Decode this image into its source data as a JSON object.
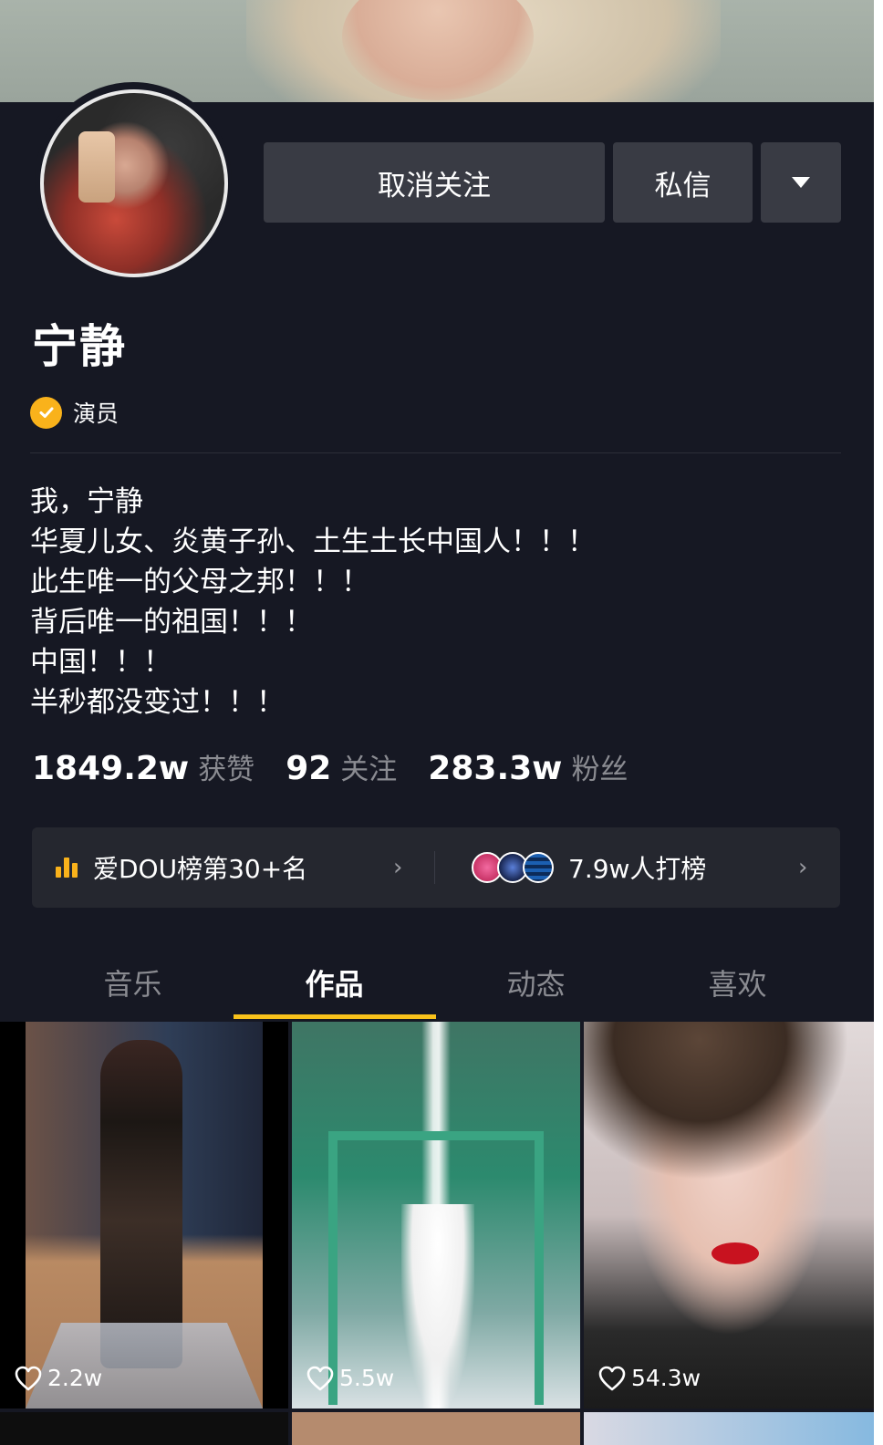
{
  "profile": {
    "name": "宁静",
    "verification": "演员",
    "bio": [
      "我，宁静",
      "华夏儿女、炎黄子孙、土生土长中国人！！！",
      "此生唯一的父母之邦！！！",
      "背后唯一的祖国！！！",
      "中国！！！",
      "半秒都没变过！！！"
    ]
  },
  "actions": {
    "unfollow": "取消关注",
    "message": "私信"
  },
  "stats": {
    "likes": {
      "value": "1849.2w",
      "label": "获赞"
    },
    "following": {
      "value": "92",
      "label": "关注"
    },
    "fans": {
      "value": "283.3w",
      "label": "粉丝"
    }
  },
  "rank": {
    "left": "爱DOU榜第30+名",
    "right": "7.9w人打榜"
  },
  "tabs": [
    {
      "label": "音乐"
    },
    {
      "label": "作品"
    },
    {
      "label": "动态"
    },
    {
      "label": "喜欢"
    }
  ],
  "active_tab": "作品",
  "videos": [
    {
      "likes": "2.2w"
    },
    {
      "likes": "5.5w"
    },
    {
      "likes": "54.3w"
    }
  ],
  "colors": {
    "background": "#161823",
    "accent": "#f9c21b",
    "verify_badge": "#f9b21b",
    "button_bg": "#393b44",
    "muted_text": "#8a8b91"
  }
}
